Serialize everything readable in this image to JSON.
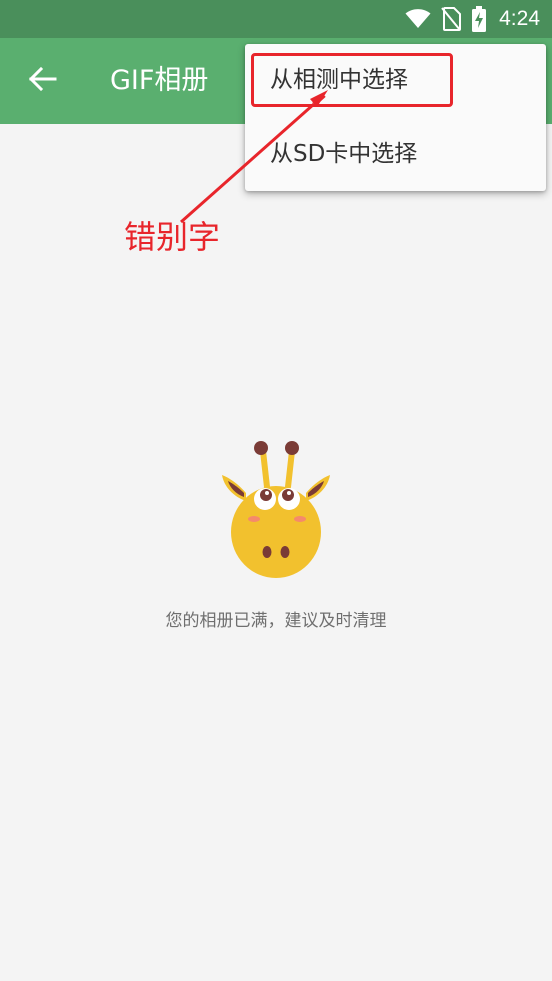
{
  "status_bar": {
    "time": "4:24",
    "icons": [
      "wifi-icon",
      "no-sim-icon",
      "battery-charging-icon"
    ]
  },
  "toolbar": {
    "back_icon": "arrow-left-icon",
    "title": "GIF相册"
  },
  "popup_menu": {
    "items": [
      {
        "label": "从相测中选择"
      },
      {
        "label": "从SD卡中选择"
      }
    ]
  },
  "annotation": {
    "label": "错别字",
    "color": "#e8252b"
  },
  "empty_state": {
    "illustration": "giraffe-mascot-icon",
    "message": "您的相册已满，建议及时清理"
  },
  "colors": {
    "status_bar": "#4a8f5b",
    "toolbar": "#5aaf6f",
    "background": "#f4f4f4",
    "mascot": "#f2c12e"
  }
}
